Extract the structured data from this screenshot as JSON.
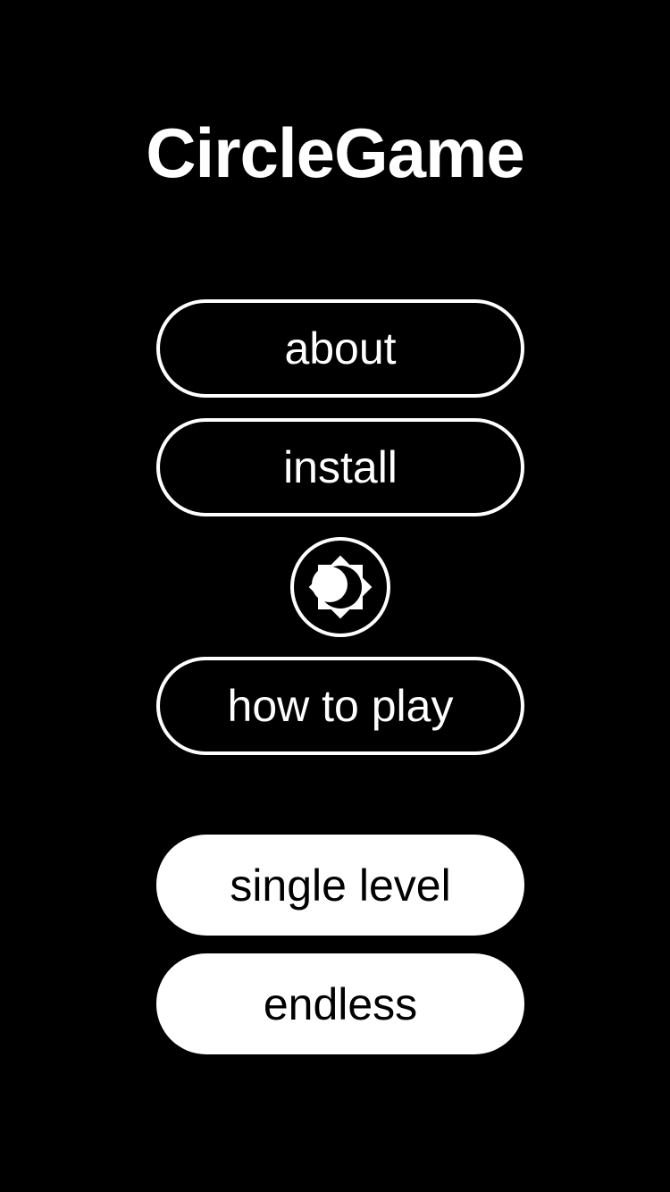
{
  "app": {
    "title": "CircleGame"
  },
  "menu": {
    "about_label": "about",
    "install_label": "install",
    "how_to_play_label": "how to play",
    "single_level_label": "single level",
    "endless_label": "endless"
  },
  "theme_toggle": {
    "icon": "dark-mode-moon-sun-icon"
  },
  "colors": {
    "background": "#000000",
    "foreground": "#ffffff"
  }
}
